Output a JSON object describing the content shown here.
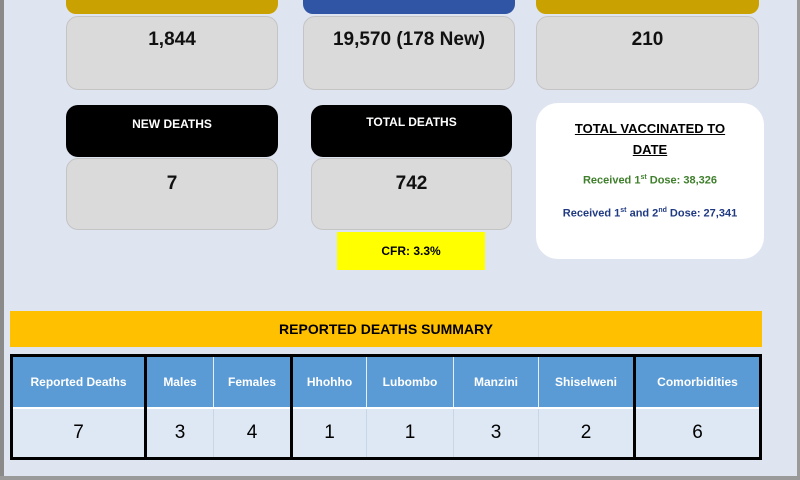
{
  "colors": {
    "gold_header": "#c9a100",
    "blue_header": "#2f55a4",
    "summary_banner": "#ffc000",
    "cfr_background": "#ffff00",
    "table_header": "#5b9bd5",
    "first_dose_text": "#3f7f2c",
    "second_dose_text": "#203a82"
  },
  "stats_top": {
    "left_value": "1,844",
    "center_value": "19,570 (178 New)",
    "right_value": "210"
  },
  "new_deaths": {
    "label": "NEW DEATHS",
    "value": "7"
  },
  "total_deaths": {
    "label": "TOTAL DEATHS",
    "value": "742"
  },
  "cfr": {
    "text": "CFR: 3.3%"
  },
  "vaccinated": {
    "title": "TOTAL VACCINATED TO DATE",
    "first_dose": {
      "prefix": "Received 1",
      "sup": "st",
      "suffix": " Dose: 38,326"
    },
    "second_dose": {
      "prefix": "Received 1",
      "sup1": "st",
      "middle": " and 2",
      "sup2": "nd",
      "suffix": " Dose: 27,341"
    }
  },
  "summary": {
    "title": "REPORTED DEATHS SUMMARY",
    "headers": [
      "Reported Deaths",
      "Males",
      "Females",
      "Hhohho",
      "Lubombo",
      "Manzini",
      "Shiselweni",
      "Comorbidities"
    ],
    "values": [
      "7",
      "3",
      "4",
      "1",
      "1",
      "3",
      "2",
      "6"
    ]
  }
}
